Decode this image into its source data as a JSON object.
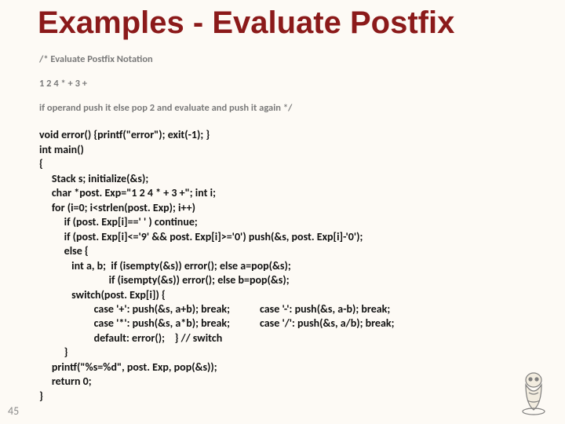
{
  "title": "Examples - Evaluate Postfix",
  "comment_lines": [
    "/* Evaluate Postfix Notation",
    "1 2 4 * + 3 +",
    "if operand push it else pop 2 and evaluate and push it again */"
  ],
  "code_lines": [
    "void error() {printf(\"error\"); exit(-1); }",
    "int main()",
    "{",
    "     Stack s; initialize(&s);",
    "     char *post. Exp=\"1 2 4 * + 3 +\"; int i;",
    "     for (i=0; i<strlen(post. Exp); i++)",
    "          if (post. Exp[i]==' ' ) continue;",
    "          if (post. Exp[i]<='9' && post. Exp[i]>='0') push(&s, post. Exp[i]-'0');",
    "          else {",
    "             int a, b;  if (isempty(&s)) error(); else a=pop(&s);",
    "                            if (isempty(&s)) error(); else b=pop(&s);",
    "             switch(post. Exp[i]) {",
    "                      case '+': push(&s, a+b); break;            case '-': push(&s, a-b); break;",
    "                      case '*': push(&s, a*b); break;            case '/': push(&s, a/b); break;",
    "                      default: error();    } // switch",
    "          }",
    "     printf(\"%s=%d\", post. Exp, pop(&s));",
    "     return 0;",
    "}"
  ],
  "page_number": "45"
}
